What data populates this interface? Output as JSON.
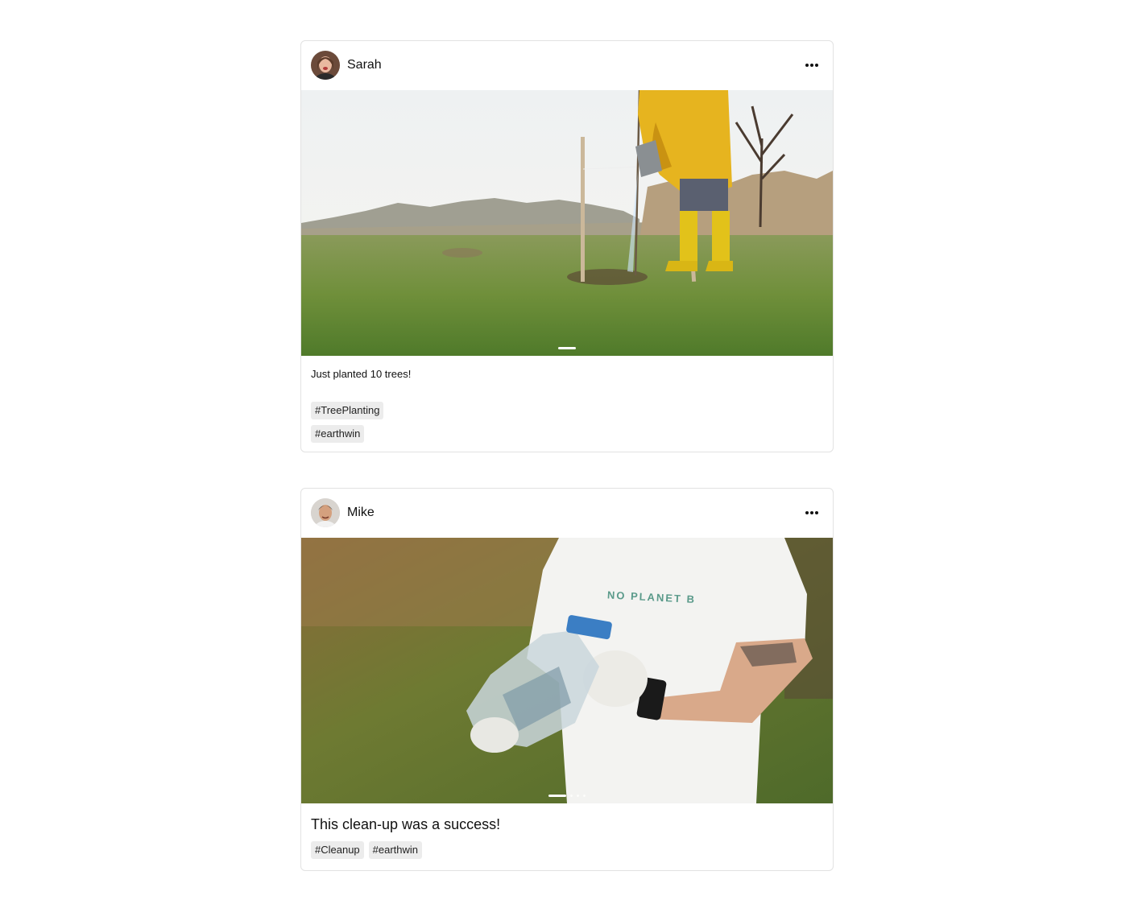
{
  "posts": [
    {
      "username": "Sarah",
      "caption": "Just planted 10 trees!",
      "tags": [
        "#TreePlanting",
        "#earthwin"
      ],
      "carousel": {
        "slides": 1,
        "active": 1
      }
    },
    {
      "username": "Mike",
      "caption": "This clean-up was a success!",
      "tags": [
        "#Cleanup",
        "#earthwin"
      ],
      "shirt_text": "NO PLANET B",
      "carousel": {
        "slides": 4,
        "active": 1
      }
    }
  ],
  "icons": {
    "more": "more-horizontal-icon"
  }
}
